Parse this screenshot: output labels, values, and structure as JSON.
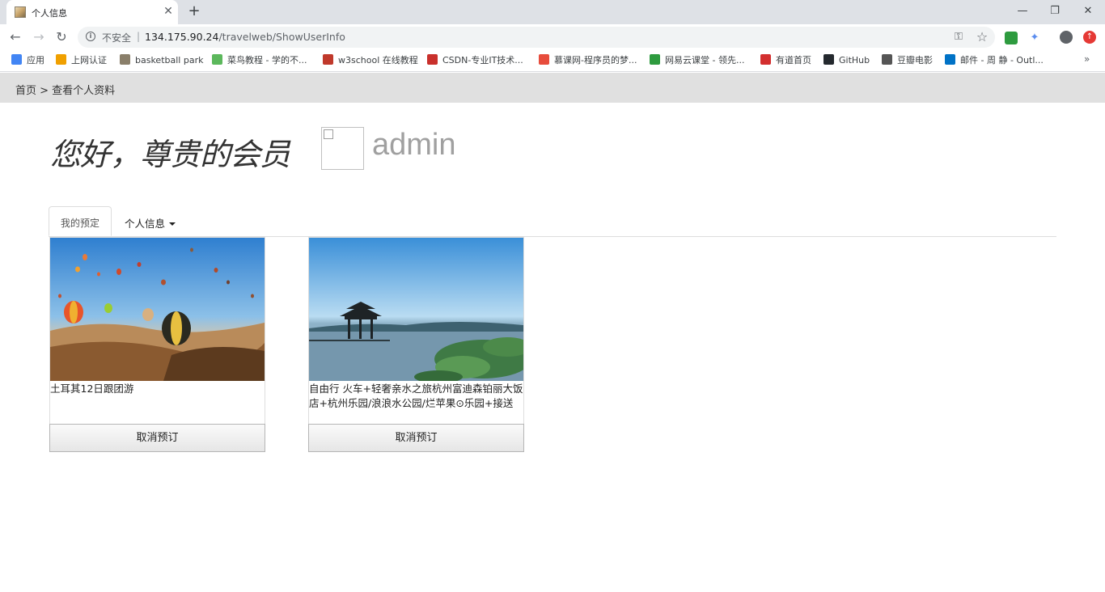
{
  "browser": {
    "tab_title": "个人信息",
    "new_tab_symbol": "+",
    "window_controls": {
      "minimize": "—",
      "maximize": "❐",
      "close": "✕"
    },
    "address": {
      "security_label": "不安全",
      "separator": "|",
      "host": "134.175.90.24",
      "path": "/travelweb/ShowUserInfo"
    },
    "bookmarks": [
      {
        "label": "应用",
        "icon": "apps-grid-icon",
        "color": "#4285f4"
      },
      {
        "label": "上网认证",
        "icon": "ep-icon",
        "color": "#f0a000"
      },
      {
        "label": "basketball park",
        "icon": "image-icon",
        "color": "#8a7f6a"
      },
      {
        "label": "菜鸟教程 - 学的不...",
        "icon": "runoob-icon",
        "color": "#5cb85c"
      },
      {
        "label": "w3school 在线教程",
        "icon": "w3school-icon",
        "color": "#c0392b"
      },
      {
        "label": "CSDN-专业IT技术...",
        "icon": "csdn-icon",
        "color": "#c9302c"
      },
      {
        "label": "慕课网-程序员的梦...",
        "icon": "flame-icon",
        "color": "#e74c3c"
      },
      {
        "label": "网易云课堂 - 领先...",
        "icon": "netease-icon",
        "color": "#2e9b3f"
      },
      {
        "label": "有道首页",
        "icon": "youdao-icon",
        "color": "#d32f2f"
      },
      {
        "label": "GitHub",
        "icon": "github-icon",
        "color": "#24292e"
      },
      {
        "label": "豆瓣电影",
        "icon": "globe-icon",
        "color": "#555555"
      },
      {
        "label": "邮件 - 周 静 - Outl...",
        "icon": "outlook-icon",
        "color": "#0072c6"
      }
    ],
    "bookmarks_more": "»"
  },
  "page": {
    "breadcrumb": "首页 > 查看个人资料",
    "greeting": "您好，尊贵的会员",
    "username": "admin",
    "tabs": {
      "active": "我的预定",
      "dropdown": "个人信息"
    },
    "bookings": [
      {
        "title": "土耳其12日跟团游",
        "image": "hot-air-balloons-photo",
        "cancel_label": "取消预订"
      },
      {
        "title": "自由行 火车+轻奢亲水之旅杭州富迪森铂丽大饭店+杭州乐园/浪浪水公园/烂苹果⊙乐园+接送",
        "image": "west-lake-pavilion-photo",
        "cancel_label": "取消预订"
      }
    ]
  },
  "colors": {
    "breadcrumb_bar": "#e0e0e0",
    "username": "#a0a0a0",
    "chrome_tabstrip": "#dee1e6"
  }
}
